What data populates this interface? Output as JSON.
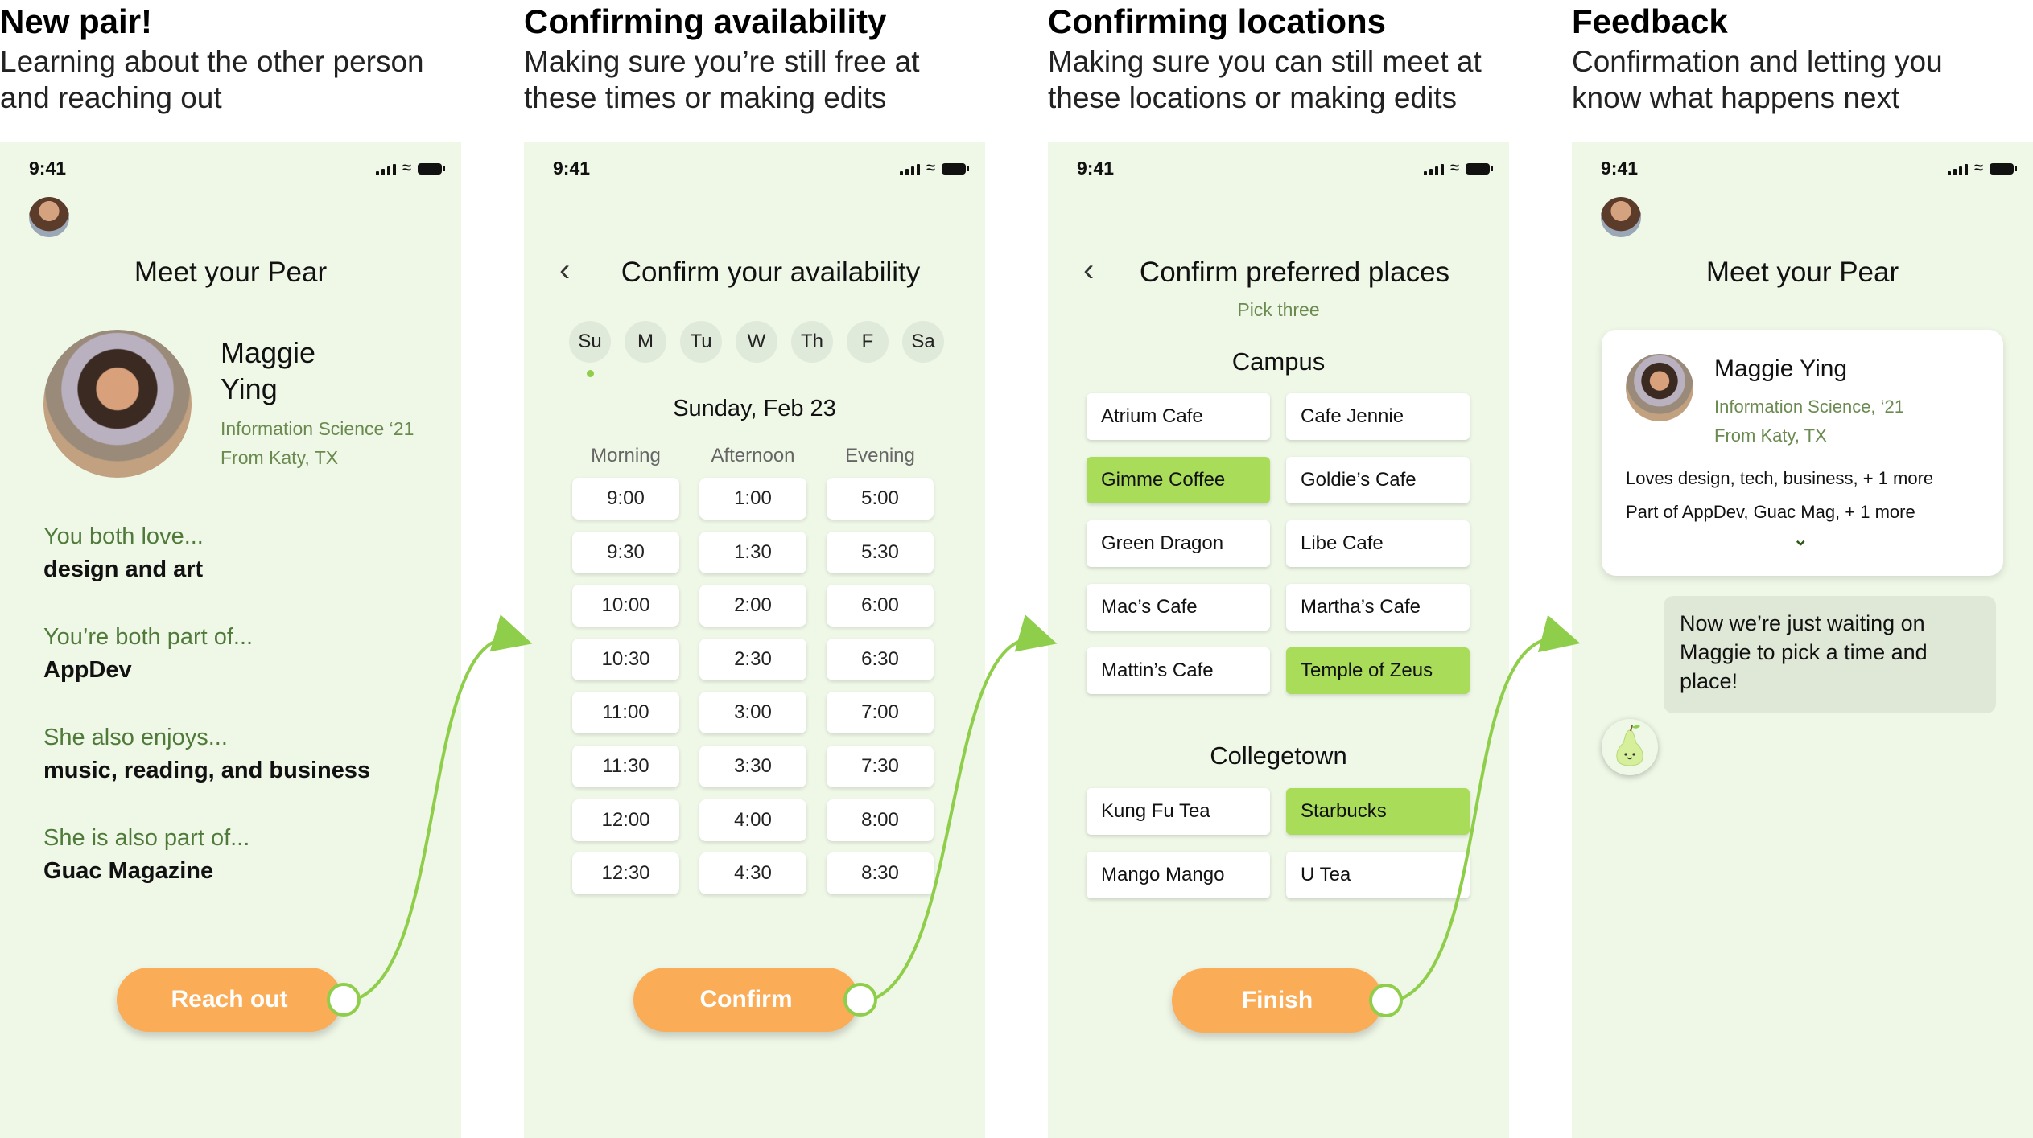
{
  "columns": [
    {
      "title": "New pair!",
      "subtitle_1": "Learning about the other person",
      "subtitle_2": "and reaching out"
    },
    {
      "title": "Confirming availability",
      "subtitle_1": "Making sure you’re still free at",
      "subtitle_2": "these times or making edits"
    },
    {
      "title": "Confirming locations",
      "subtitle_1": "Making sure you can still meet at",
      "subtitle_2": "these locations or making edits"
    },
    {
      "title": "Feedback",
      "subtitle_1": "Confirmation and letting you",
      "subtitle_2": "know what happens next"
    }
  ],
  "status_time": "9:41",
  "screen1": {
    "title": "Meet your Pear",
    "first_name": "Maggie",
    "last_name": "Ying",
    "major": "Information Science ‘21",
    "hometown": "From Katy, TX",
    "facts": [
      {
        "label": "You both love...",
        "value": "design and art"
      },
      {
        "label": "You’re both part of...",
        "value": "AppDev"
      },
      {
        "label": "She also enjoys...",
        "value": "music, reading, and business"
      },
      {
        "label": "She is also part of...",
        "value": "Guac Magazine"
      }
    ],
    "button": "Reach out"
  },
  "screen2": {
    "title": "Confirm your availability",
    "days": [
      "Su",
      "M",
      "Tu",
      "W",
      "Th",
      "F",
      "Sa"
    ],
    "date": "Sunday, Feb 23",
    "columns": [
      {
        "header": "Morning",
        "times": [
          "9:00",
          "9:30",
          "10:00",
          "10:30",
          "11:00",
          "11:30",
          "12:00",
          "12:30"
        ]
      },
      {
        "header": "Afternoon",
        "times": [
          "1:00",
          "1:30",
          "2:00",
          "2:30",
          "3:00",
          "3:30",
          "4:00",
          "4:30"
        ]
      },
      {
        "header": "Evening",
        "times": [
          "5:00",
          "5:30",
          "6:00",
          "6:30",
          "7:00",
          "7:30",
          "8:00",
          "8:30"
        ]
      }
    ],
    "button": "Confirm"
  },
  "screen3": {
    "title": "Confirm preferred places",
    "subtitle": "Pick three",
    "section1": "Campus",
    "campus": [
      {
        "name": "Atrium Cafe",
        "selected": false
      },
      {
        "name": "Cafe Jennie",
        "selected": false
      },
      {
        "name": "Gimme Coffee",
        "selected": true
      },
      {
        "name": "Goldie’s Cafe",
        "selected": false
      },
      {
        "name": "Green Dragon",
        "selected": false
      },
      {
        "name": "Libe Cafe",
        "selected": false
      },
      {
        "name": "Mac’s Cafe",
        "selected": false
      },
      {
        "name": "Martha’s Cafe",
        "selected": false
      },
      {
        "name": "Mattin’s Cafe",
        "selected": false
      },
      {
        "name": "Temple of Zeus",
        "selected": true
      }
    ],
    "section2": "Collegetown",
    "collegetown": [
      {
        "name": "Kung Fu Tea",
        "selected": false
      },
      {
        "name": "Starbucks",
        "selected": true
      },
      {
        "name": "Mango Mango",
        "selected": false
      },
      {
        "name": "U Tea",
        "selected": false
      }
    ],
    "button": "Finish"
  },
  "screen4": {
    "title": "Meet your Pear",
    "name": "Maggie Ying",
    "major": "Information Science, ‘21",
    "hometown": "From Katy, TX",
    "loves": "Loves design, tech, business, + 1 more",
    "part_of": "Part of AppDev, Guac Mag, + 1 more",
    "message": "Now we’re just waiting on Maggie to pick a time and place!"
  },
  "colors": {
    "background": "#eff7e7",
    "accent_orange": "#fbac57",
    "accent_green": "#a9dc59",
    "text_green": "#4f7a3a"
  }
}
